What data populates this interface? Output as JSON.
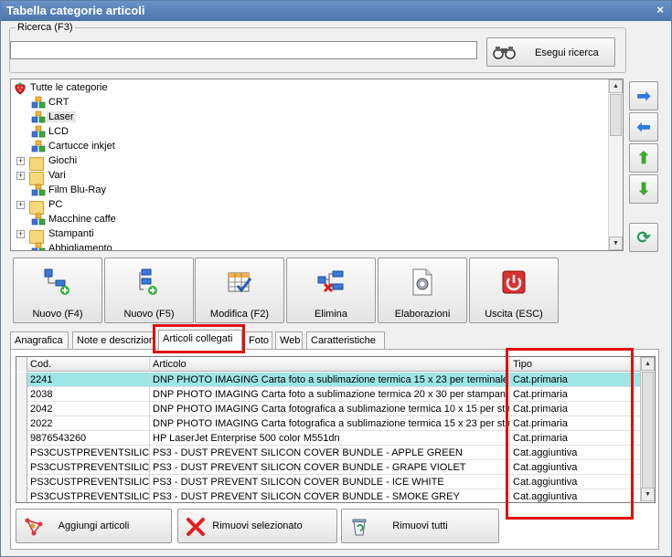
{
  "window": {
    "title": "Tabella categorie articoli",
    "close_label": "×"
  },
  "search": {
    "group_label": "Ricerca (F3)",
    "input_value": "",
    "button_label": "Esegui ricerca",
    "button_icon": "binoculars-icon"
  },
  "tree": {
    "root": {
      "label": "Tutte le categorie",
      "icon": "strawberry-icon"
    },
    "items": [
      {
        "label": "CRT",
        "type": "category",
        "expandable": false,
        "selected": false
      },
      {
        "label": "Laser",
        "type": "category",
        "expandable": false,
        "selected": true
      },
      {
        "label": "LCD",
        "type": "category",
        "expandable": false,
        "selected": false
      },
      {
        "label": "Cartucce inkjet",
        "type": "category",
        "expandable": false,
        "selected": false
      },
      {
        "label": "Giochi",
        "type": "folder",
        "expandable": true,
        "selected": false
      },
      {
        "label": "Vari",
        "type": "folder",
        "expandable": true,
        "selected": false
      },
      {
        "label": "Film Blu-Ray",
        "type": "category",
        "expandable": false,
        "selected": false
      },
      {
        "label": "PC",
        "type": "folder",
        "expandable": true,
        "selected": false
      },
      {
        "label": "Macchine caffe",
        "type": "category",
        "expandable": false,
        "selected": false
      },
      {
        "label": "Stampanti",
        "type": "folder",
        "expandable": true,
        "selected": false
      },
      {
        "label": "Abbigliamento",
        "type": "category",
        "expandable": false,
        "selected": false
      }
    ]
  },
  "side_buttons": [
    {
      "name": "move-right",
      "icon": "arrow-right-icon",
      "glyph": "➡",
      "color": "#2a7be0"
    },
    {
      "name": "move-left",
      "icon": "arrow-left-icon",
      "glyph": "⬅",
      "color": "#2a7be0"
    },
    {
      "name": "move-up",
      "icon": "arrow-up-icon",
      "glyph": "⬆",
      "color": "#3aa82a"
    },
    {
      "name": "move-down",
      "icon": "arrow-down-icon",
      "glyph": "⬇",
      "color": "#3aa82a"
    },
    {
      "name": "refresh",
      "icon": "refresh-icon",
      "glyph": "⟳",
      "color": "#2a9a5a"
    }
  ],
  "toolbar": {
    "new_f4": "Nuovo (F4)",
    "new_f5": "Nuovo (F5)",
    "edit": "Modifica (F2)",
    "delete": "Elimina",
    "process": "Elaborazioni",
    "exit": "Uscita (ESC)"
  },
  "tabs": [
    {
      "label": "Anagrafica",
      "active": false
    },
    {
      "label": "Note e descrizioni",
      "active": false
    },
    {
      "label": "Articoli collegati",
      "active": true
    },
    {
      "label": "Foto",
      "active": false
    },
    {
      "label": "Web",
      "active": false
    },
    {
      "label": "Caratteristiche",
      "active": false
    }
  ],
  "grid": {
    "columns": [
      "Cod.",
      "Articolo",
      "Tipo"
    ],
    "rows": [
      {
        "cod": "2241",
        "articolo": "DNP PHOTO IMAGING Carta foto a sublimazione termica 15 x 23 per terminale ...",
        "tipo": "Cat.primaria",
        "selected": true
      },
      {
        "cod": "2038",
        "articolo": "DNP PHOTO IMAGING Carta foto a sublimazione termica 20 x 30 per stampant...",
        "tipo": "Cat.primaria",
        "selected": false
      },
      {
        "cod": "2042",
        "articolo": "DNP PHOTO IMAGING Carta fotografica a sublimazione termica 10 x 15 per sta...",
        "tipo": "Cat.primaria",
        "selected": false
      },
      {
        "cod": "2022",
        "articolo": "DNP PHOTO IMAGING Carta fotografica a sublimazione termica 15 x 23 per sta...",
        "tipo": "Cat.primaria",
        "selected": false
      },
      {
        "cod": "9876543260",
        "articolo": "HP LaserJet Enterprise 500 color M551dn",
        "tipo": "Cat.primaria",
        "selected": false
      },
      {
        "cod": "PS3CUSTPREVENTSILIC...",
        "articolo": "PS3 - DUST PREVENT SILICON COVER BUNDLE - APPLE GREEN",
        "tipo": "Cat.aggiuntiva",
        "selected": false
      },
      {
        "cod": "PS3CUSTPREVENTSILIC...",
        "articolo": "PS3 - DUST PREVENT SILICON COVER BUNDLE - GRAPE VIOLET",
        "tipo": "Cat.aggiuntiva",
        "selected": false
      },
      {
        "cod": "PS3CUSTPREVENTSILIC...",
        "articolo": "PS3 - DUST PREVENT SILICON COVER BUNDLE - ICE WHITE",
        "tipo": "Cat.aggiuntiva",
        "selected": false
      },
      {
        "cod": "PS3CUSTPREVENTSILIC...",
        "articolo": "PS3 - DUST PREVENT SILICON COVER BUNDLE - SMOKE GREY",
        "tipo": "Cat.aggiuntiva",
        "selected": false
      }
    ]
  },
  "bottom_buttons": {
    "add": "Aggiungi articoli",
    "remove_selected": "Rimuovi selezionato",
    "remove_all": "Rimuovi tutti"
  },
  "colors": {
    "selection_row": "#9ee6e6",
    "highlight_box": "#e01010",
    "title_bar": "#5a84b8"
  }
}
